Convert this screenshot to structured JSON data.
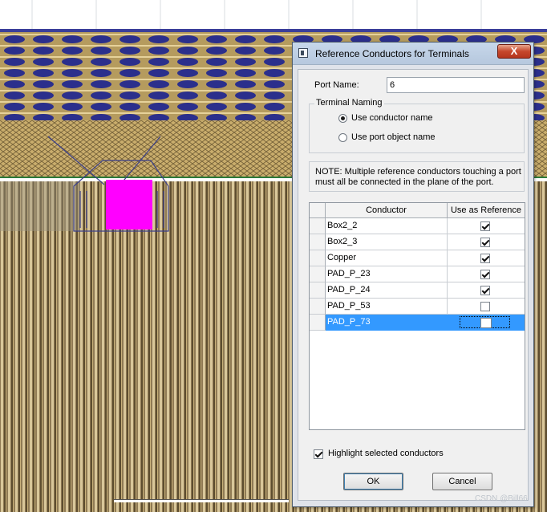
{
  "dialog": {
    "title": "Reference Conductors for Terminals",
    "close_label": "X",
    "port_name_label": "Port Name:",
    "port_name_value": "6",
    "terminal_naming": {
      "legend": "Terminal Naming",
      "options": [
        {
          "label": "Use conductor name",
          "selected": true
        },
        {
          "label": "Use port object name",
          "selected": false
        }
      ]
    },
    "note": "NOTE: Multiple reference conductors touching a port must all be connected in the plane of the port.",
    "table": {
      "columns": [
        "Conductor",
        "Use as Reference"
      ],
      "rows": [
        {
          "conductor": "Box2_2",
          "use_as_reference": true
        },
        {
          "conductor": "Box2_3",
          "use_as_reference": true
        },
        {
          "conductor": "Copper",
          "use_as_reference": true
        },
        {
          "conductor": "PAD_P_23",
          "use_as_reference": true
        },
        {
          "conductor": "PAD_P_24",
          "use_as_reference": true
        },
        {
          "conductor": "PAD_P_53",
          "use_as_reference": false
        },
        {
          "conductor": "PAD_P_73",
          "use_as_reference": false,
          "selected": true
        }
      ]
    },
    "highlight_label": "Highlight selected conductors",
    "highlight_checked": true,
    "ok_label": "OK",
    "cancel_label": "Cancel"
  },
  "watermark": "CSDN @Bill66",
  "colors": {
    "selection": "#3399ff",
    "port_highlight": "#ff00ff",
    "substrate_blue": "#2a2f8f",
    "trace_gold": "#b8963e"
  }
}
